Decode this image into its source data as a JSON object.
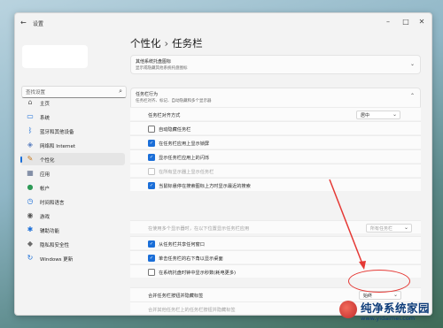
{
  "app": {
    "title": "设置",
    "back_icon": "back-arrow-icon",
    "controls": [
      "minimize-icon",
      "maximize-icon",
      "close-icon"
    ]
  },
  "search": {
    "placeholder": "查找设置"
  },
  "sidebar": {
    "items": [
      {
        "label": "主页",
        "icon": "home-icon",
        "color": "#5a5a5a"
      },
      {
        "label": "系统",
        "icon": "system-icon",
        "color": "#1a6ed8"
      },
      {
        "label": "蓝牙和其他设备",
        "icon": "bluetooth-icon",
        "color": "#1a6ed8"
      },
      {
        "label": "网络和 Internet",
        "icon": "network-icon",
        "color": "#5a7fbf"
      },
      {
        "label": "个性化",
        "icon": "brush-icon",
        "color": "#c9781a",
        "active": true
      },
      {
        "label": "应用",
        "icon": "apps-icon",
        "color": "#5a6a8a"
      },
      {
        "label": "帐户",
        "icon": "account-icon",
        "color": "#2e9a57"
      },
      {
        "label": "时间和语言",
        "icon": "time-language-icon",
        "color": "#1a6ed8"
      },
      {
        "label": "游戏",
        "icon": "game-icon",
        "color": "#555555"
      },
      {
        "label": "辅助功能",
        "icon": "accessibility-icon",
        "color": "#1a6ed8"
      },
      {
        "label": "隐私和安全性",
        "icon": "shield-icon",
        "color": "#6b6b6b"
      },
      {
        "label": "Windows 更新",
        "icon": "update-icon",
        "color": "#1a6ed8"
      }
    ]
  },
  "breadcrumb": {
    "parent": "个性化",
    "separator": "›",
    "current": "任务栏"
  },
  "other_tray": {
    "title": "其他系统托盘图标",
    "subtitle": "显示或隐藏其他系统托盘图标"
  },
  "behaviors": {
    "title": "任务栏行为",
    "subtitle": "任务栏对齐、标记、自动隐藏和多个显示器",
    "alignment": {
      "label": "任务栏对齐方式",
      "value": "居中"
    },
    "options": [
      {
        "label": "自动隐藏任务栏",
        "checked": false,
        "disabled": false
      },
      {
        "label": "在任务栏应用上显示锁屏",
        "checked": true,
        "disabled": false
      },
      {
        "label": "显示任务栏应用上的闪烁",
        "checked": true,
        "disabled": false
      },
      {
        "label": "在所有显示器上显示任务栏",
        "checked": false,
        "disabled": true
      },
      {
        "label": "当鼠标悬停在搜索图标上方时显示最近的搜索",
        "checked": true,
        "disabled": false
      }
    ],
    "multi_display": {
      "label": "在使用多个显示器时，在以下位置显示任务栏应用",
      "value": "所有任务栏"
    },
    "options2": [
      {
        "label": "从任务栏共享任何窗口",
        "checked": true,
        "disabled": false
      },
      {
        "label": "单击任务栏的右下角以显示桌面",
        "checked": true,
        "disabled": false
      },
      {
        "label": "在系统托盘时钟中显示秒数(耗电更多)",
        "checked": false,
        "disabled": false
      }
    ],
    "combine": {
      "label": "合并任务栏按钮并隐藏标签",
      "value": "始终"
    },
    "combine_other": {
      "label": "合并其他任务栏上的任务栏按钮并隐藏标签"
    }
  },
  "watermark": {
    "title": "纯净系统家园",
    "url": "www.yidaimei.com"
  },
  "colors": {
    "accent": "#1a6ed8",
    "annotation": "#e53935"
  }
}
